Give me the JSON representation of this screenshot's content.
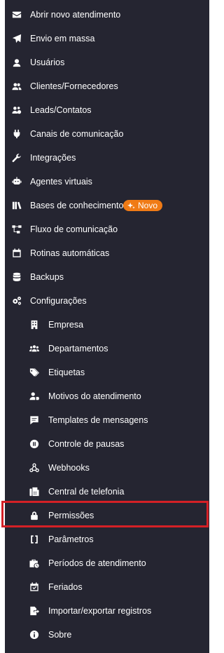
{
  "menu": {
    "abrir": "Abrir novo atendimento",
    "envio": "Envio em massa",
    "usuarios": "Usuários",
    "clientes": "Clientes/Fornecedores",
    "leads": "Leads/Contatos",
    "canais": "Canais de comunicação",
    "integracoes": "Integrações",
    "agentes": "Agentes virtuais",
    "bases": "Bases de conhecimento",
    "bases_badge": "Novo",
    "fluxo": "Fluxo de comunicação",
    "rotinas": "Rotinas automáticas",
    "backups": "Backups",
    "configuracoes": "Configurações"
  },
  "submenu": {
    "empresa": "Empresa",
    "departamentos": "Departamentos",
    "etiquetas": "Etiquetas",
    "motivos": "Motivos do atendimento",
    "templates": "Templates de mensagens",
    "pausas": "Controle de pausas",
    "webhooks": "Webhooks",
    "telefonia": "Central de telefonia",
    "permissoes": "Permissões",
    "parametros": "Parâmetros",
    "periodos": "Períodos de atendimento",
    "feriados": "Feriados",
    "importar": "Importar/exportar registros",
    "sobre": "Sobre"
  },
  "theme": {
    "sidebar_bg": "#252531",
    "text": "#ffffff",
    "badge_bg": "#f07b16",
    "highlight": "#d42026"
  },
  "active_item": "Permissões"
}
